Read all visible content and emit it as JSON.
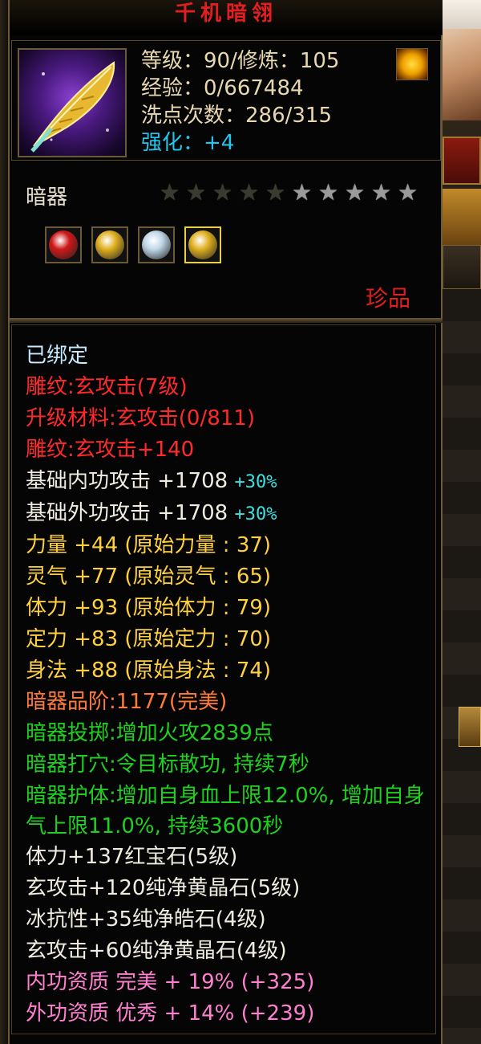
{
  "title": "千机暗翎",
  "header": {
    "level_line": "等级：90/修炼：105",
    "exp_line": "经验：0/667484",
    "wash_line": "洗点次数：286/315",
    "enhance_label": "强化：",
    "enhance_value": "+4"
  },
  "item_type": "暗器",
  "stars": {
    "lit": 5,
    "total": 10
  },
  "gems": [
    {
      "icon": "red-gem-icon",
      "color": "#d01818"
    },
    {
      "icon": "yellow-gem-icon",
      "color": "#e0b020"
    },
    {
      "icon": "white-gem-icon",
      "color": "#c0d8e8"
    },
    {
      "icon": "yellow-gem-icon",
      "color": "#e0b020"
    }
  ],
  "rarity": "珍品",
  "attributes": [
    {
      "text": "已绑定",
      "color": "cyan"
    },
    {
      "text": "雕纹:玄攻击(7级)",
      "color": "red"
    },
    {
      "text": "升级材料:玄攻击(0/811)",
      "color": "red"
    },
    {
      "text": "雕纹:玄攻击+140",
      "color": "red"
    },
    {
      "text": "基础内功攻击 +1708 ",
      "color": "white",
      "pct": "+30%"
    },
    {
      "text": "基础外功攻击 +1708 ",
      "color": "white",
      "pct": "+30%"
    },
    {
      "text": "力量 +44 (原始力量 : 37)",
      "color": "yellow"
    },
    {
      "text": "灵气 +77 (原始灵气 : 65)",
      "color": "yellow"
    },
    {
      "text": "体力 +93 (原始体力 : 79)",
      "color": "yellow"
    },
    {
      "text": "定力 +83 (原始定力 : 70)",
      "color": "yellow"
    },
    {
      "text": "身法 +88 (原始身法 : 74)",
      "color": "yellow"
    },
    {
      "text": "暗器品阶:1177(完美)",
      "color": "orange"
    },
    {
      "text": "暗器投掷:增加火攻2839点",
      "color": "green"
    },
    {
      "text": "暗器打穴:令目标散功, 持续7秒",
      "color": "green"
    },
    {
      "text": "暗器护体:增加自身血上限12.0%, 增加自身气上限11.0%, 持续3600秒",
      "color": "green",
      "wrap": true
    },
    {
      "text": "体力+137红宝石(5级)",
      "color": "white"
    },
    {
      "text": "玄攻击+120纯净黄晶石(5级)",
      "color": "white"
    },
    {
      "text": "冰抗性+35纯净皓石(4级)",
      "color": "white"
    },
    {
      "text": "玄攻击+60纯净黄晶石(4级)",
      "color": "white"
    },
    {
      "text": "内功资质 完美 + 19% (+325)",
      "color": "pink"
    },
    {
      "text": "外功资质 优秀 + 14% (+239)",
      "color": "pink"
    }
  ]
}
